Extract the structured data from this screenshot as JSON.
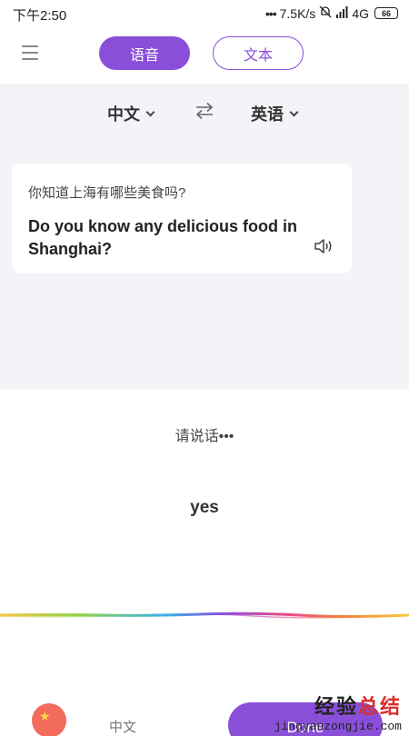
{
  "status_bar": {
    "time": "下午2:50",
    "net_speed": "7.5K/s",
    "network": "4G",
    "battery": "66"
  },
  "tabs": {
    "voice_label": "语音",
    "text_label": "文本"
  },
  "languages": {
    "source": "中文",
    "target": "英语"
  },
  "card": {
    "source_text": "你知道上海有哪些美食吗?",
    "translated_text": "Do you know any delicious food in Shanghai?"
  },
  "listening": {
    "prompt": "请说话•••",
    "recognized_text": "yes"
  },
  "bottom": {
    "language_label": "中文",
    "done_label": "Done"
  },
  "watermark": {
    "main_a": "经验",
    "main_b": "总结",
    "url": "jingyanzongjie.com"
  },
  "colors": {
    "accent": "#8a4fd8",
    "background_gray": "#f4f3f8"
  },
  "icons": [
    "menu-icon",
    "swap-icon",
    "speaker-icon",
    "chevron-down-icon",
    "flag-icon"
  ]
}
